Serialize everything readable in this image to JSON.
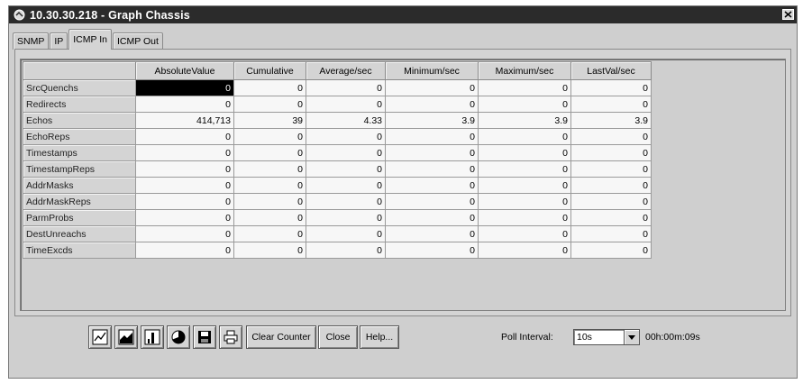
{
  "window": {
    "title": "10.30.30.218 - Graph Chassis"
  },
  "tabs": [
    {
      "label": "SNMP",
      "active": false
    },
    {
      "label": "IP",
      "active": false
    },
    {
      "label": "ICMP In",
      "active": true
    },
    {
      "label": "ICMP Out",
      "active": false
    }
  ],
  "table": {
    "columns": [
      "",
      "AbsoluteValue",
      "Cumulative",
      "Average/sec",
      "Minimum/sec",
      "Maximum/sec",
      "LastVal/sec"
    ],
    "rows": [
      {
        "label": "SrcQuenchs",
        "values": [
          "0",
          "0",
          "0",
          "0",
          "0",
          "0"
        ]
      },
      {
        "label": "Redirects",
        "values": [
          "0",
          "0",
          "0",
          "0",
          "0",
          "0"
        ]
      },
      {
        "label": "Echos",
        "values": [
          "414,713",
          "39",
          "4.33",
          "3.9",
          "3.9",
          "3.9"
        ]
      },
      {
        "label": "EchoReps",
        "values": [
          "0",
          "0",
          "0",
          "0",
          "0",
          "0"
        ]
      },
      {
        "label": "Timestamps",
        "values": [
          "0",
          "0",
          "0",
          "0",
          "0",
          "0"
        ]
      },
      {
        "label": "TimestampReps",
        "values": [
          "0",
          "0",
          "0",
          "0",
          "0",
          "0"
        ]
      },
      {
        "label": "AddrMasks",
        "values": [
          "0",
          "0",
          "0",
          "0",
          "0",
          "0"
        ]
      },
      {
        "label": "AddrMaskReps",
        "values": [
          "0",
          "0",
          "0",
          "0",
          "0",
          "0"
        ]
      },
      {
        "label": "ParmProbs",
        "values": [
          "0",
          "0",
          "0",
          "0",
          "0",
          "0"
        ]
      },
      {
        "label": "DestUnreachs",
        "values": [
          "0",
          "0",
          "0",
          "0",
          "0",
          "0"
        ]
      },
      {
        "label": "TimeExcds",
        "values": [
          "0",
          "0",
          "0",
          "0",
          "0",
          "0"
        ]
      }
    ]
  },
  "toolbar": {
    "icon_buttons": [
      "line-chart-icon",
      "area-chart-icon",
      "bar-chart-icon",
      "pie-chart-icon",
      "save-icon",
      "print-icon"
    ],
    "clear_counter_label": "Clear Counter",
    "close_label": "Close",
    "help_label": "Help...",
    "poll_interval_label": "Poll Interval:",
    "poll_interval_value": "10s",
    "elapsed": "00h:00m:09s"
  }
}
